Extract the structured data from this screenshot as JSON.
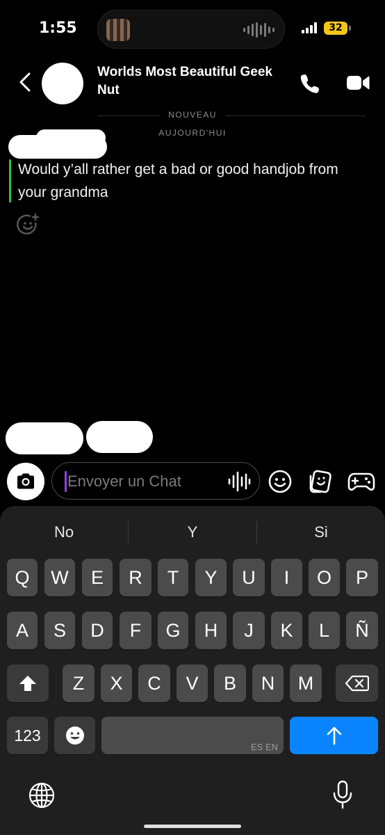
{
  "status_bar": {
    "time": "1:55",
    "battery": "32"
  },
  "header": {
    "title": "Worlds Most Beautiful Geek Nut"
  },
  "labels": {
    "new": "NOUVEAU",
    "today": "AUJOURD'HUI"
  },
  "message": {
    "text": "Would y’all rather get a bad or good handjob from your grandma"
  },
  "input": {
    "placeholder": "Envoyer un Chat"
  },
  "keyboard": {
    "suggestions": [
      "No",
      "Y",
      "Si"
    ],
    "row1": [
      "Q",
      "W",
      "E",
      "R",
      "T",
      "Y",
      "U",
      "I",
      "O",
      "P"
    ],
    "row2": [
      "A",
      "S",
      "D",
      "F",
      "G",
      "H",
      "J",
      "K",
      "L",
      "Ñ"
    ],
    "row3": [
      "Z",
      "X",
      "C",
      "V",
      "B",
      "N",
      "M"
    ],
    "numbers_key": "123",
    "space_label": "ES EN",
    "accent": "#0a84ff"
  },
  "icons": [
    "back-chevron",
    "phone",
    "video-camera",
    "add-reaction",
    "camera",
    "voice-note",
    "emoji",
    "sticker",
    "game-controller",
    "shift",
    "delete",
    "emoji-keyboard",
    "return-arrow",
    "globe",
    "microphone"
  ]
}
